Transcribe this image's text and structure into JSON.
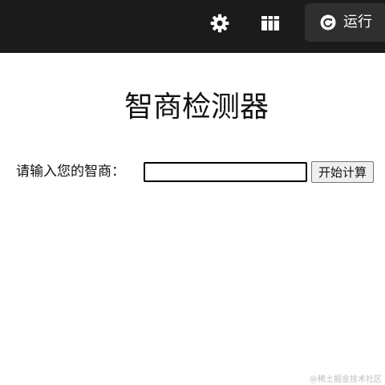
{
  "toolbar": {
    "settings_icon": "gear-icon",
    "layout_icon": "layout-grid-icon",
    "run_icon": "refresh-circle-icon",
    "run_label": "运行",
    "colors": {
      "background": "#1b1b1b",
      "run_button": "#2f2f2f",
      "icon": "#ffffff"
    }
  },
  "main": {
    "title": "智商检测器",
    "form": {
      "label": "请输入您的智商：",
      "input_value": "",
      "button_label": "开始计算"
    }
  },
  "watermark": "@稀土掘金技术社区"
}
